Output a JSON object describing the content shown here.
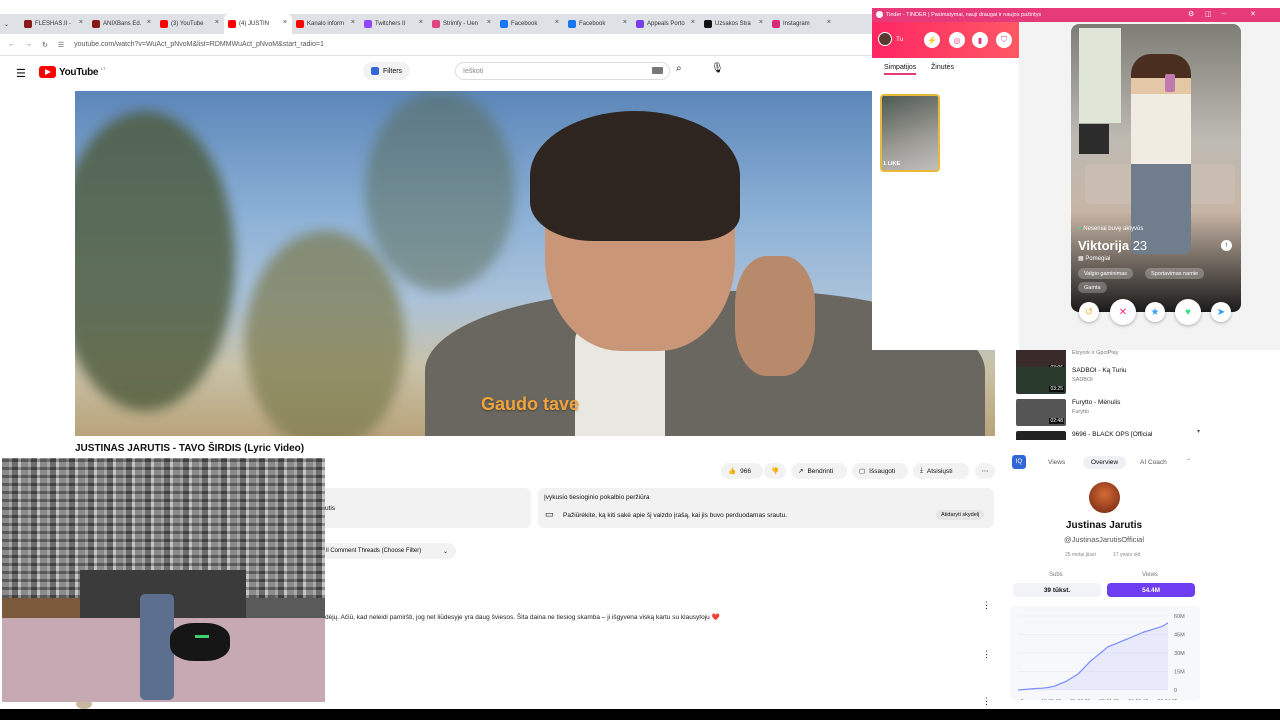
{
  "browser": {
    "tabs": [
      {
        "label": "FLESHAS.II -",
        "color": "#8b1a1a"
      },
      {
        "label": "ANIXBans Ed.",
        "color": "#8b1a1a"
      },
      {
        "label": "(3) YouTube",
        "color": "#ff0000"
      },
      {
        "label": "(4) JUSTIN",
        "color": "#ff0000"
      },
      {
        "label": "Kanalo inform",
        "color": "#ff0000"
      },
      {
        "label": "Twitchers II",
        "color": "#9146ff"
      },
      {
        "label": "Strimfy - Uen",
        "color": "#e0457b"
      },
      {
        "label": "Facebook",
        "color": "#1877f2"
      },
      {
        "label": "Facebook",
        "color": "#1877f2"
      },
      {
        "label": "Appeals Porto",
        "color": "#7b3fe4"
      },
      {
        "label": "Uzsakos Stra",
        "color": "#111111"
      },
      {
        "label": "Instagram",
        "color": "#d62976"
      }
    ],
    "url": "youtube.com/watch?v=WuAct_pNvoM&list=RDMMWuAct_pNvoM&start_radio=1"
  },
  "youtube": {
    "logo": "YouTube",
    "logo_sup": "LT",
    "filters": "Filters",
    "search_placeholder": "Ieškoti",
    "lyric": "Gaudo tave",
    "title": "JUSTINAS JARUTIS - TAVO ŠIRDIS (Lyric Video)",
    "likes": "966",
    "share": "Bendrinti",
    "save": "Išsaugoti",
    "download": "Atsisiųsti",
    "live_title": "Įvykusio tiesioginio pokalbio peržiūra",
    "live_text": "Pažiūrėkite, ką kiti sakė apie šį vaizdo įrašą, kai jis buvo perduodamas srautu.",
    "live_btn": "Atidaryti skydelį",
    "panel_frag": "utis",
    "comment_filter": "ll Comment Threads (Choose Filter)",
    "comment_text": "dėjų. Ačiū, kad neleidi pamiršti, jog net liūdesyje yra daug šviesos. Šita daina ne tiesiog skamba – ji išgyvena viską kartu su klausytoju ❤️"
  },
  "tinder": {
    "window_title": "Tinder - TINDER | Pasimatymai, nauji draugai ir naujos pažintys",
    "me": "Tu",
    "tab_likes": "Simpatijos",
    "tab_messages": "Žinutės",
    "likes_label": "1 LIKE",
    "active": "Neseniai buvę aktyvūs",
    "name": "Viktorija",
    "age": "23",
    "looking": "Pomėgiai",
    "chips": [
      "Valgio gaminimas",
      "Sportavimas namie",
      "Gamta"
    ]
  },
  "recommendations": [
    {
      "duration": "03:06",
      "title": "",
      "channel": "Elzyork ir GpctPlay"
    },
    {
      "duration": "03:25",
      "title": "SADBOI - Ką Turiu",
      "channel": "SADBOI"
    },
    {
      "duration": "02:48",
      "title": "Furytto - Mėnulis",
      "channel": "Furytto"
    },
    {
      "duration": "",
      "title": "9696 - BLACK OPS [Official",
      "channel": ""
    }
  ],
  "analytics": {
    "tabs": [
      "Views",
      "Overview",
      "AI Coach"
    ],
    "selected": "Overview",
    "name": "Justinas Jarutis",
    "handle": "@JustinasJarutisOfficial",
    "meta1": "25 metai jūsėi",
    "meta2": "17 years old",
    "subs_label": "Subs",
    "subs_value": "39 tūkst.",
    "views_label": "Views",
    "views_value": "54.4M",
    "chart_color": "#7b8cff"
  },
  "chart_data": {
    "type": "line",
    "y_ticks": [
      "60M",
      "45M",
      "30M",
      "15M",
      "0"
    ],
    "x_ticks": [
      "0",
      "19-09-07",
      "21-06-20",
      "23-01-31",
      "24-09-12",
      "26-04-25"
    ],
    "ylim": [
      0,
      60
    ],
    "values": [
      0,
      0.4,
      0.8,
      1.2,
      1.5,
      2,
      3,
      5,
      7,
      10,
      13,
      18,
      23,
      27,
      31,
      35,
      37,
      39,
      41,
      43,
      45,
      47,
      48.5,
      50,
      51.5,
      54.4
    ]
  }
}
